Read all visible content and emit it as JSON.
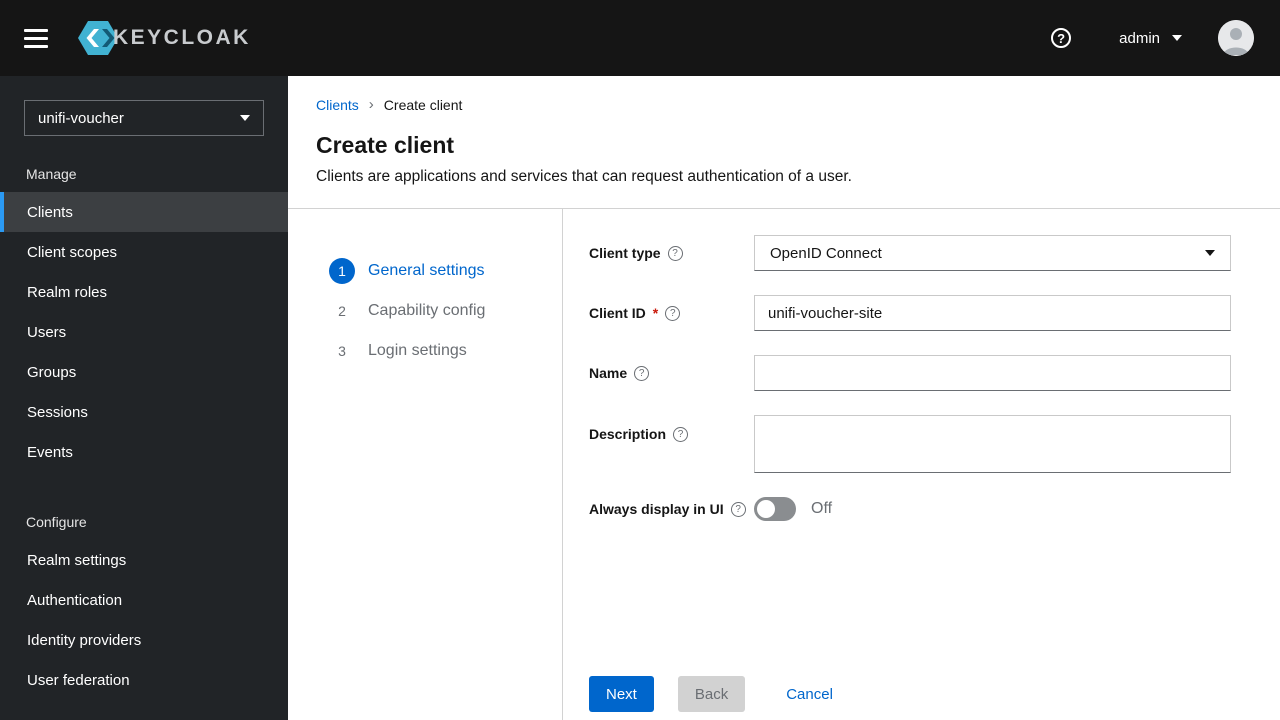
{
  "header": {
    "brand": "KEYCLOAK",
    "username": "admin"
  },
  "sidebar": {
    "realm": "unifi-voucher",
    "manage_label": "Manage",
    "manage_items": [
      "Clients",
      "Client scopes",
      "Realm roles",
      "Users",
      "Groups",
      "Sessions",
      "Events"
    ],
    "configure_label": "Configure",
    "configure_items": [
      "Realm settings",
      "Authentication",
      "Identity providers",
      "User federation"
    ],
    "active_item": "Clients"
  },
  "breadcrumb": {
    "parent": "Clients",
    "current": "Create client"
  },
  "page": {
    "title": "Create client",
    "subtitle": "Clients are applications and services that can request authentication of a user."
  },
  "wizard": {
    "steps": [
      {
        "number": "1",
        "label": "General settings",
        "active": true
      },
      {
        "number": "2",
        "label": "Capability config",
        "active": false
      },
      {
        "number": "3",
        "label": "Login settings",
        "active": false
      }
    ]
  },
  "form": {
    "client_type": {
      "label": "Client type",
      "value": "OpenID Connect"
    },
    "client_id": {
      "label": "Client ID",
      "required_marker": "*",
      "value": "unifi-voucher-site"
    },
    "name": {
      "label": "Name",
      "value": ""
    },
    "description": {
      "label": "Description",
      "value": ""
    },
    "always_display": {
      "label": "Always display in UI",
      "state": "Off",
      "enabled": false
    }
  },
  "actions": {
    "next": "Next",
    "back": "Back",
    "cancel": "Cancel"
  },
  "colors": {
    "accent": "#0066cc",
    "link": "#0066cc",
    "required": "#c9190b",
    "nav_active_border": "#2b9af3",
    "brand_icon": "#41b2d2",
    "topbar_bg": "#151515",
    "sidebar_bg": "#212427"
  }
}
